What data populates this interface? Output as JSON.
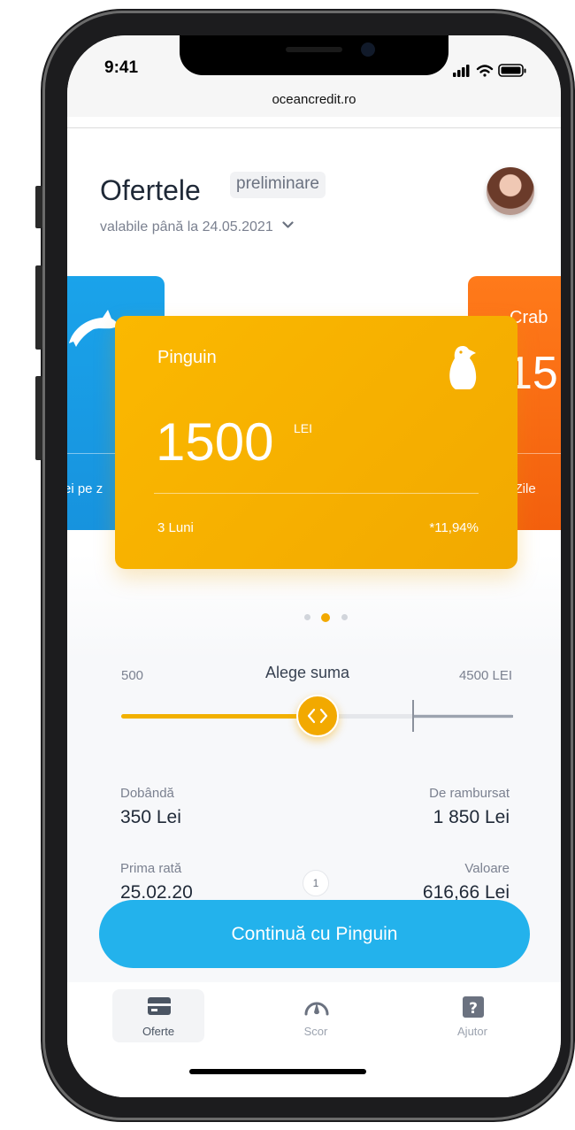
{
  "status_bar": {
    "time": "9:41",
    "url": "oceancredit.ro"
  },
  "header": {
    "title": "Ofertele",
    "tag": "preliminare",
    "validity": "valabile până la 24.05.2021"
  },
  "cards": {
    "left_peek": {
      "text": "ei pe z",
      "color": "#1a9ee5",
      "icon": "dolphin-icon"
    },
    "main": {
      "name": "Pinguin",
      "amount": "1500",
      "currency": "LEI",
      "term": "3 Luni",
      "rate": "*11,94%",
      "color": "#f5ae00",
      "icon": "penguin-icon"
    },
    "right_peek": {
      "name": "Crab",
      "amount": "15",
      "term": "5 Zile",
      "color": "#f66a12"
    }
  },
  "carousel": {
    "total_dots": 3,
    "active_index": 1
  },
  "slider": {
    "min_label": "500",
    "title": "Alege suma",
    "max_label": "4500 LEI",
    "value_fraction": 0.5,
    "handle_icon": "code-arrows-icon"
  },
  "details": {
    "interest_label": "Dobândă",
    "interest_value": "350 Lei",
    "repay_label": "De rambursat",
    "repay_value": "1 850 Lei",
    "first_rate_label": "Prima rată",
    "first_rate_value": "25.02.20",
    "installment_label": "Valoare",
    "installment_value": "616,66 Lei",
    "page_number": "1"
  },
  "cta": {
    "label": "Continuă cu Pinguin",
    "color": "#23b2ec"
  },
  "tabs": [
    {
      "label": "Oferte",
      "icon": "card-icon",
      "active": true
    },
    {
      "label": "Scor",
      "icon": "gauge-icon",
      "active": false
    },
    {
      "label": "Ajutor",
      "icon": "help-icon",
      "active": false
    }
  ]
}
